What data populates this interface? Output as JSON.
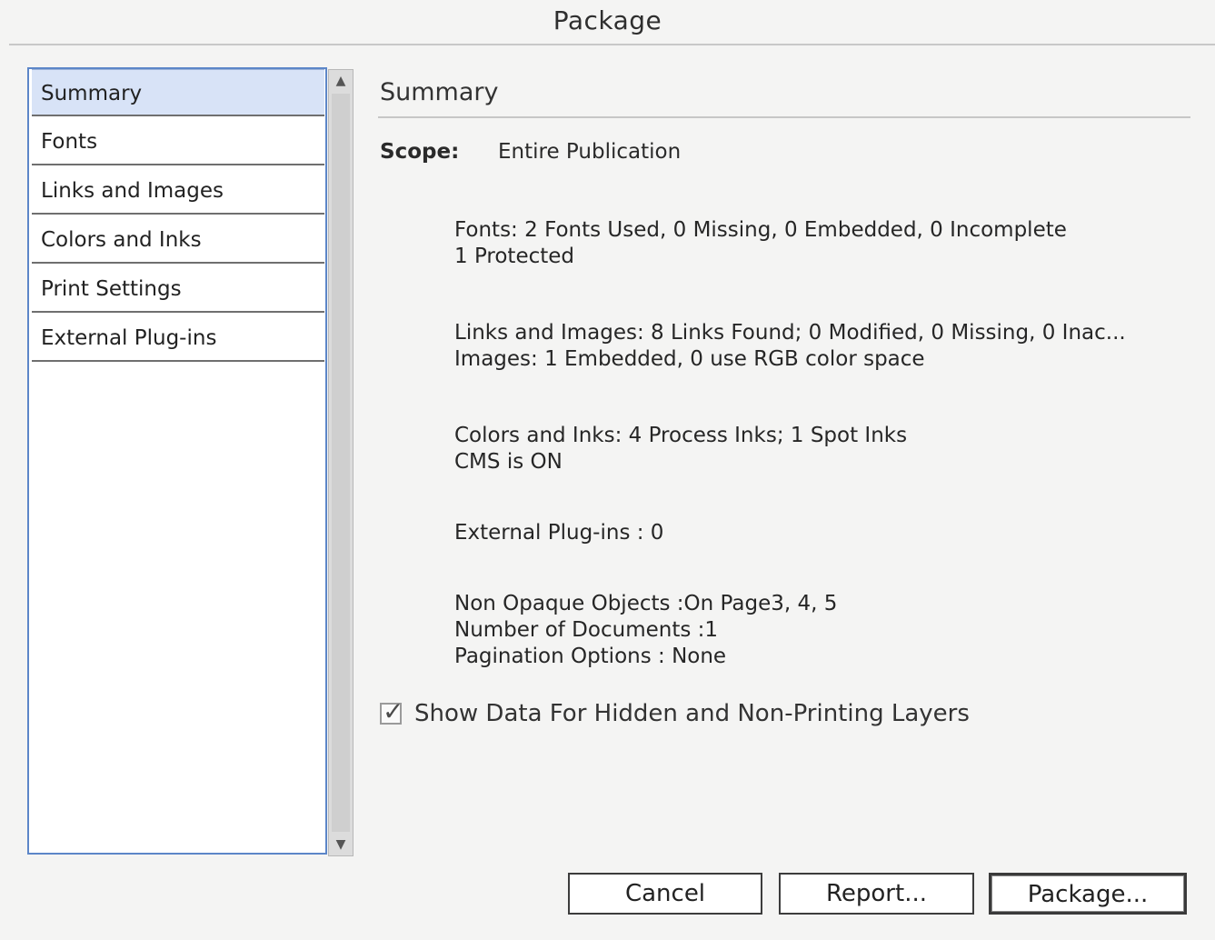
{
  "window": {
    "title": "Package"
  },
  "sidebar": {
    "items": [
      {
        "label": "Summary"
      },
      {
        "label": "Fonts"
      },
      {
        "label": "Links and Images"
      },
      {
        "label": "Colors and Inks"
      },
      {
        "label": "Print Settings"
      },
      {
        "label": "External Plug-ins"
      }
    ],
    "selected": "Summary"
  },
  "main": {
    "section_title": "Summary",
    "scope_label": "Scope:",
    "scope_value": "Entire Publication",
    "fonts": {
      "line1": "Fonts: 2 Fonts Used, 0 Missing, 0 Embedded, 0 Incomplete",
      "line2": "1 Protected"
    },
    "links": {
      "line1": "Links and Images: 8 Links Found; 0 Modified, 0 Missing, 0 Inac...",
      "line2": "Images: 1 Embedded, 0 use RGB color space"
    },
    "colors": {
      "line1": "Colors and Inks: 4 Process Inks; 1 Spot Inks",
      "line2": "CMS is ON"
    },
    "plugins": {
      "line1": "External Plug-ins : 0"
    },
    "other": {
      "line1": "Non Opaque Objects :On Page3, 4, 5",
      "line2": "Number of Documents :1",
      "line3": "Pagination Options : None"
    },
    "show_hidden": {
      "label": "Show Data For Hidden and Non-Printing Layers",
      "checked": true
    }
  },
  "buttons": {
    "cancel": "Cancel",
    "report": "Report...",
    "package": "Package..."
  },
  "icons": {
    "scroll_up": "▲",
    "scroll_down": "▼",
    "check": "✓"
  }
}
